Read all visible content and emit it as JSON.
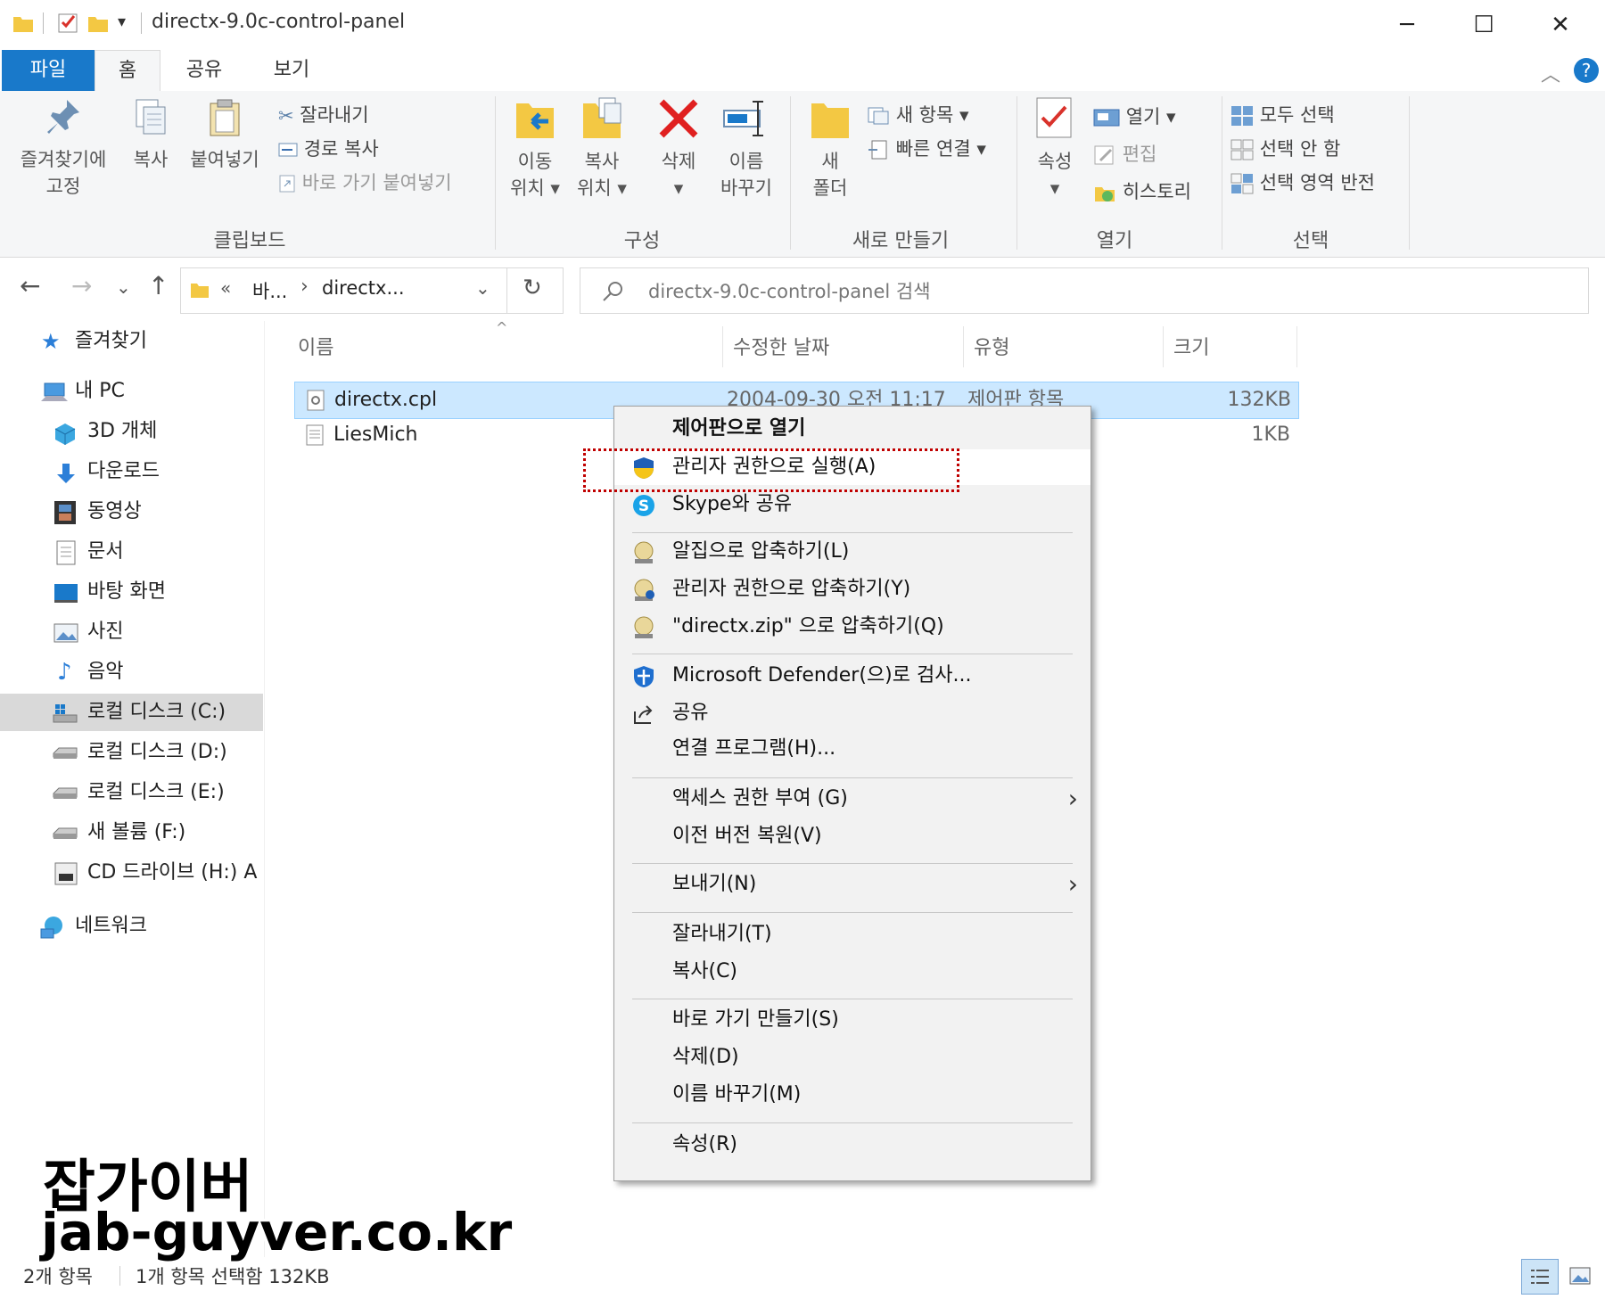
{
  "window": {
    "title": "directx-9.0c-control-panel",
    "minimize": "─",
    "maximize": "☐",
    "close": "✕"
  },
  "tabs": [
    {
      "label": "파일"
    },
    {
      "label": "홈"
    },
    {
      "label": "공유"
    },
    {
      "label": "보기"
    }
  ],
  "ribbon": {
    "clipboard": {
      "pin_line1": "즐겨찾기에",
      "pin_line2": "고정",
      "copy": "복사",
      "paste": "붙여넣기",
      "cut": "잘라내기",
      "copy_path": "경로 복사",
      "paste_shortcut": "바로 가기 붙여넣기",
      "group": "클립보드"
    },
    "organize": {
      "move_line1": "이동",
      "move_line2": "위치 ▾",
      "copyto_line1": "복사",
      "copyto_line2": "위치 ▾",
      "delete_line1": "삭제",
      "delete_line2": "▾",
      "rename_line1": "이름",
      "rename_line2": "바꾸기",
      "group": "구성"
    },
    "new": {
      "folder_line1": "새",
      "folder_line2": "폴더",
      "new_item": "새 항목 ▾",
      "easy_access": "빠른 연결 ▾",
      "group": "새로 만들기"
    },
    "open": {
      "props_line1": "속성",
      "props_line2": "▾",
      "open": "열기 ▾",
      "edit": "편집",
      "history": "히스토리",
      "group": "열기"
    },
    "select": {
      "all": "모두 선택",
      "none": "선택 안 함",
      "invert": "선택 영역 반전",
      "group": "선택"
    }
  },
  "address": {
    "crumb1": "바...",
    "crumb2": "directx...",
    "chevrons": "«",
    "sep": "›",
    "search_placeholder": "directx-9.0c-control-panel 검색"
  },
  "sidebar": [
    {
      "label": "즐겨찾기"
    },
    {
      "label": "내 PC"
    },
    {
      "label": "3D 개체"
    },
    {
      "label": "다운로드"
    },
    {
      "label": "동영상"
    },
    {
      "label": "문서"
    },
    {
      "label": "바탕 화면"
    },
    {
      "label": "사진"
    },
    {
      "label": "음악"
    },
    {
      "label": "로컬 디스크 (C:)"
    },
    {
      "label": "로컬 디스크 (D:)"
    },
    {
      "label": "로컬 디스크 (E:)"
    },
    {
      "label": "새 볼륨 (F:)"
    },
    {
      "label": "CD 드라이브 (H:) A"
    },
    {
      "label": "네트워크"
    }
  ],
  "columns": {
    "name": "이름",
    "date": "수정한 날짜",
    "type": "유형",
    "size": "크기"
  },
  "files": [
    {
      "name": "directx.cpl",
      "date": "2004-09-30 오전 11:17",
      "type": "제어판 항목",
      "size": "132KB"
    },
    {
      "name": "LiesMich",
      "date": "",
      "type": "",
      "size": "1KB"
    }
  ],
  "context_menu": [
    {
      "label": "제어판으로 열기"
    },
    {
      "label": "관리자 권한으로 실행(A)"
    },
    {
      "label": "Skype와 공유"
    },
    {
      "label": "알집으로 압축하기(L)"
    },
    {
      "label": "관리자 권한으로 압축하기(Y)"
    },
    {
      "label": "\"directx.zip\" 으로 압축하기(Q)"
    },
    {
      "label": "Microsoft Defender(으)로 검사..."
    },
    {
      "label": "공유"
    },
    {
      "label": "연결 프로그램(H)..."
    },
    {
      "label": "액세스 권한 부여 (G)"
    },
    {
      "label": "이전 버전 복원(V)"
    },
    {
      "label": "보내기(N)"
    },
    {
      "label": "잘라내기(T)"
    },
    {
      "label": "복사(C)"
    },
    {
      "label": "바로 가기 만들기(S)"
    },
    {
      "label": "삭제(D)"
    },
    {
      "label": "이름 바꾸기(M)"
    },
    {
      "label": "속성(R)"
    }
  ],
  "watermark": {
    "line1": "잡가이버",
    "line2": "jab-guyver.co.kr"
  },
  "status": {
    "count": "2개 항목",
    "selected": "1개 항목 선택함 132KB"
  },
  "colors": {
    "accent": "#1979ca",
    "selection": "#cce8ff",
    "highlight_border": "#c00000"
  }
}
